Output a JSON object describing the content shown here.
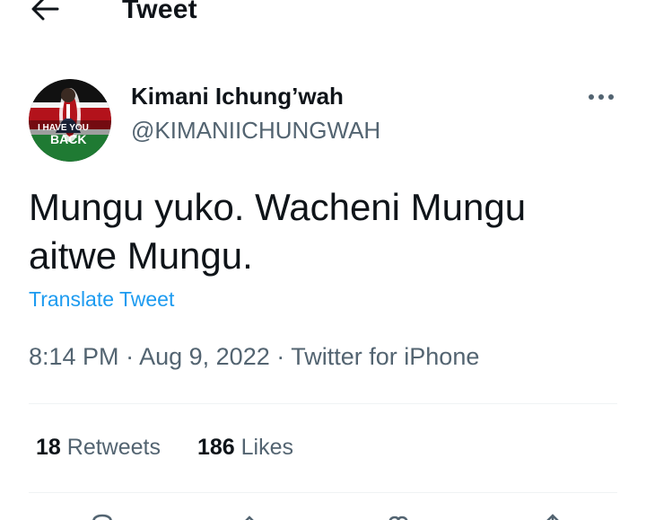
{
  "header": {
    "title": "Tweet"
  },
  "author": {
    "display_name": "Kimani Ichung’wah",
    "handle": "@KIMANIICHUNGWAH",
    "avatar_banner_line1": "I HAVE YOU",
    "avatar_banner_line2": "BACK"
  },
  "tweet": {
    "text": "Mungu yuko. Wacheni Mungu aitwe Mungu.",
    "translate_label": "Translate Tweet",
    "time": "8:14 PM",
    "separator": "·",
    "date": "Aug 9, 2022",
    "source": "Twitter for iPhone"
  },
  "stats": {
    "retweets_count": "18",
    "retweets_label": "Retweets",
    "likes_count": "186",
    "likes_label": "Likes"
  },
  "colors": {
    "accent": "#1d9bf0",
    "secondary_text": "#536471",
    "primary_text": "#0f1419",
    "divider": "#eff3f4"
  },
  "icons": {
    "back": "arrow-left-icon",
    "more": "more-horizontal-icon",
    "reply": "reply-icon",
    "retweet": "retweet-icon",
    "like": "heart-icon",
    "share": "share-icon"
  }
}
